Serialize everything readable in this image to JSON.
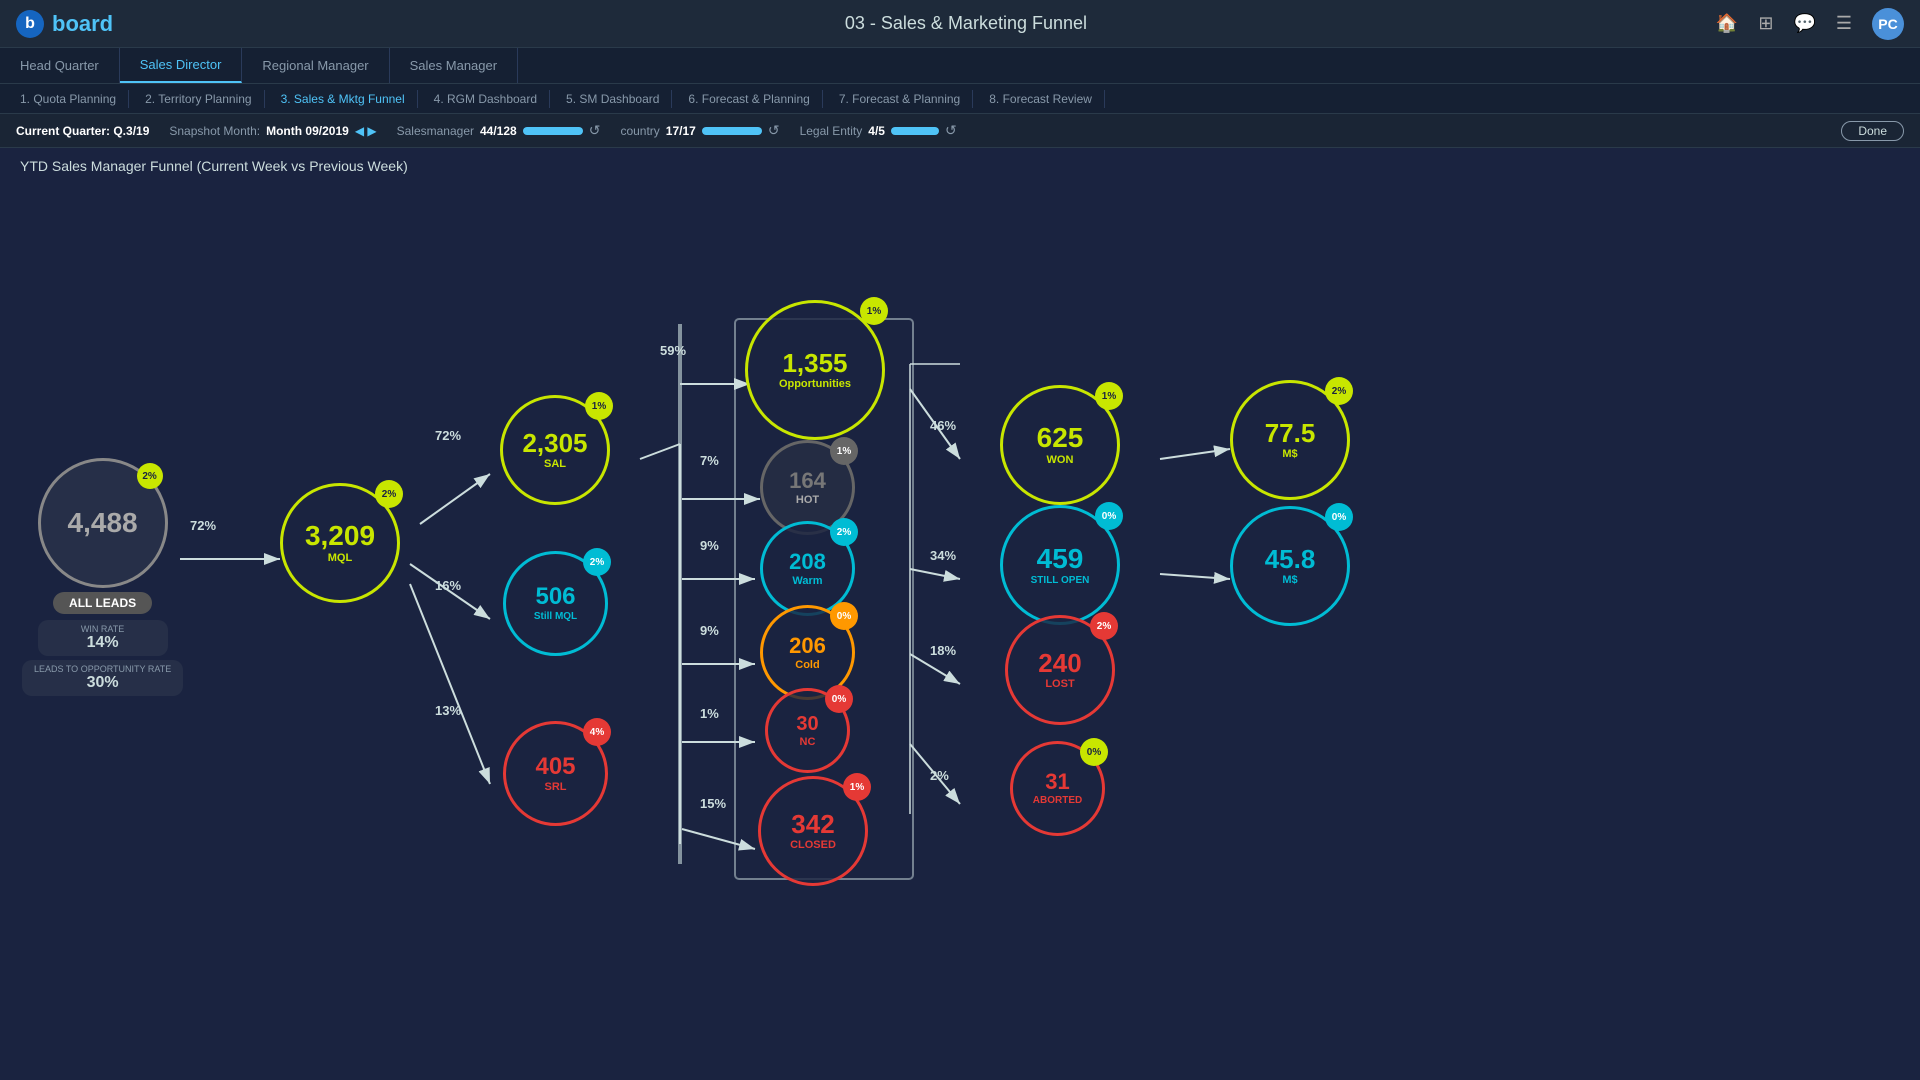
{
  "app": {
    "logo_letter": "b",
    "logo_name": "board",
    "page_title": "03 - Sales & Marketing Funnel",
    "avatar_initials": "PC"
  },
  "nav": {
    "tabs": [
      {
        "label": "Head Quarter",
        "active": false
      },
      {
        "label": "Sales Director",
        "active": true
      },
      {
        "label": "Regional Manager",
        "active": false
      },
      {
        "label": "Sales Manager",
        "active": false
      }
    ],
    "sub_tabs": [
      {
        "label": "1. Quota Planning",
        "active": false
      },
      {
        "label": "2. Territory Planning",
        "active": false
      },
      {
        "label": "3. Sales & Mktg Funnel",
        "active": true
      },
      {
        "label": "4. RGM Dashboard",
        "active": false
      },
      {
        "label": "5. SM Dashboard",
        "active": false
      },
      {
        "label": "6. Forecast & Planning",
        "active": false
      },
      {
        "label": "7. Forecast & Planning",
        "active": false
      },
      {
        "label": "8. Forecast Review",
        "active": false
      }
    ]
  },
  "filters": {
    "current_quarter_label": "Current Quarter: Q.3/19",
    "snapshot_month_label": "Snapshot Month:",
    "snapshot_month_value": "Month 09/2019",
    "salesmanager_label": "Salesmanager",
    "salesmanager_value": "44/128",
    "country_label": "country",
    "country_value": "17/17",
    "legal_entity_label": "Legal Entity",
    "legal_entity_value": "4/5",
    "done_label": "Done"
  },
  "chart": {
    "title": "YTD Sales Manager Funnel (Current Week vs Previous Week)",
    "nodes": {
      "all_leads": {
        "value": "4,488",
        "badge": "2%",
        "label": "ALL LEADS"
      },
      "win_rate": {
        "label": "WIN RATE",
        "value": "14%"
      },
      "leads_to_opp": {
        "label": "LEADS TO OPPORTUNITY RATE",
        "value": "30%"
      },
      "mql": {
        "value": "3,209",
        "badge": "2%",
        "label": "MQL"
      },
      "sal": {
        "value": "2,305",
        "badge": "1%",
        "label": "SAL"
      },
      "still_mql": {
        "value": "506",
        "badge": "2%",
        "label": "Still MQL"
      },
      "srl": {
        "value": "405",
        "badge": "4%",
        "label": "SRL"
      },
      "opportunities": {
        "value": "1,355",
        "badge": "1%",
        "label": "Opportunities"
      },
      "hot": {
        "value": "164",
        "badge": "1%",
        "label": "HOT"
      },
      "warm": {
        "value": "208",
        "badge": "2%",
        "label": "Warm"
      },
      "cold": {
        "value": "206",
        "badge": "0%",
        "label": "Cold"
      },
      "nc": {
        "value": "30",
        "badge": "0%",
        "label": "NC"
      },
      "closed": {
        "value": "342",
        "badge": "1%",
        "label": "CLOSED"
      },
      "won": {
        "value": "625",
        "badge": "1%",
        "label": "WON"
      },
      "still_open": {
        "value": "459",
        "badge": "0%",
        "label": "STILL OPEN"
      },
      "lost": {
        "value": "240",
        "badge": "2%",
        "label": "LOST"
      },
      "aborted": {
        "value": "31",
        "badge": "0%",
        "label": "ABORTED"
      },
      "won_ms": {
        "value": "77.5",
        "badge": "2%",
        "label": "M$"
      },
      "still_open_ms": {
        "value": "45.8",
        "badge": "0%",
        "label": "M$"
      }
    },
    "arrows": {
      "leads_to_mql": "72%",
      "mql_to_sal": "72%",
      "mql_to_still_mql": "16%",
      "mql_to_srl": "13%",
      "sal_to_opp": "59%",
      "opp_to_hot": "7%",
      "opp_to_warm": "9%",
      "opp_to_cold": "9%",
      "opp_to_nc": "1%",
      "opp_to_closed": "15%",
      "opp_to_won": "46%",
      "opp_to_still_open": "34%",
      "opp_to_lost": "18%",
      "opp_to_aborted": "2%"
    }
  }
}
